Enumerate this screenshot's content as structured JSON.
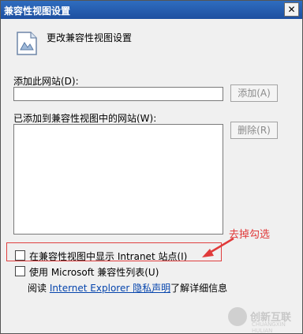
{
  "window": {
    "title": "兼容性视图设置",
    "close_glyph": "✕"
  },
  "header": {
    "text": "更改兼容性视图设置"
  },
  "add_site": {
    "label": "添加此网站(D):",
    "input_value": "",
    "button_label": "添加(A)"
  },
  "added_sites": {
    "label": "已添加到兼容性视图中的网站(W):",
    "items": [],
    "remove_button_label": "删除(R)"
  },
  "options": {
    "intranet": {
      "label": "在兼容性视图中显示 Intranet 站点(I)",
      "checked": false
    },
    "ms_list": {
      "label": "使用 Microsoft 兼容性列表(U)",
      "checked": false
    }
  },
  "privacy": {
    "prefix": "阅读",
    "link_text": "Internet Explorer 隐私声明",
    "suffix": "了解详细信息"
  },
  "annotation": {
    "text": "去掉勾选",
    "color": "#e03a3a"
  },
  "watermark": {
    "text": "创新互联",
    "sub": "CHUANGXIN HULIAN"
  }
}
